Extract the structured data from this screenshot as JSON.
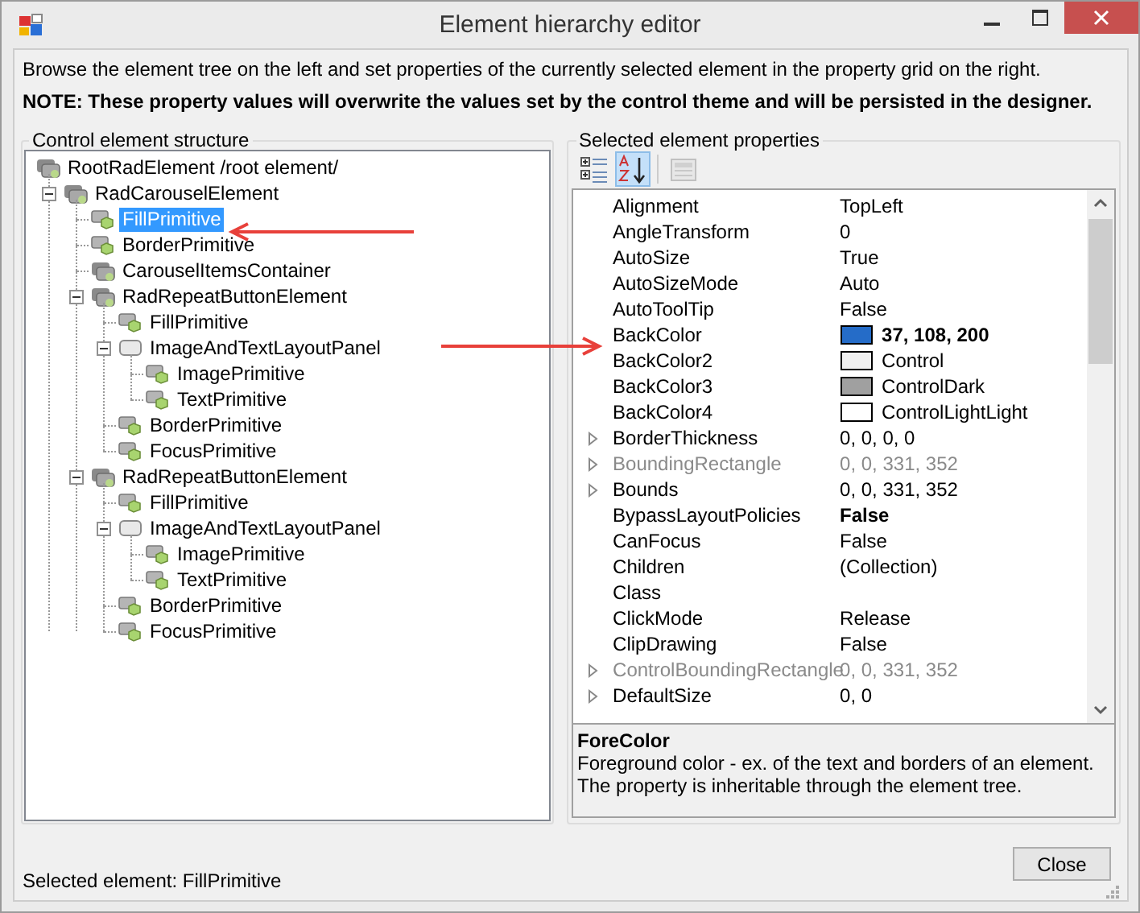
{
  "window": {
    "title": "Element hierarchy editor"
  },
  "intro": "Browse the element tree on the left and set properties of the currently selected element in the property grid on the right.",
  "note": "NOTE: These property values will overwrite the values set by the control theme and will be persisted in the designer.",
  "tree_panel": {
    "title": "Control element structure",
    "nodes": [
      {
        "label": "RootRadElement /root element/",
        "kind": "element",
        "selected": false,
        "expanded": true,
        "children": [
          {
            "label": "RadCarouselElement",
            "kind": "element",
            "selected": false,
            "expanded": true,
            "children": [
              {
                "label": "FillPrimitive",
                "kind": "primitive",
                "selected": true
              },
              {
                "label": "BorderPrimitive",
                "kind": "primitive",
                "selected": false
              },
              {
                "label": "CarouselItemsContainer",
                "kind": "element",
                "selected": false
              },
              {
                "label": "RadRepeatButtonElement",
                "kind": "element",
                "selected": false,
                "expanded": true,
                "children": [
                  {
                    "label": "FillPrimitive",
                    "kind": "primitive",
                    "selected": false
                  },
                  {
                    "label": "ImageAndTextLayoutPanel",
                    "kind": "panel",
                    "selected": false,
                    "expanded": true,
                    "children": [
                      {
                        "label": "ImagePrimitive",
                        "kind": "primitive",
                        "selected": false
                      },
                      {
                        "label": "TextPrimitive",
                        "kind": "primitive",
                        "selected": false
                      }
                    ]
                  },
                  {
                    "label": "BorderPrimitive",
                    "kind": "primitive",
                    "selected": false
                  },
                  {
                    "label": "FocusPrimitive",
                    "kind": "primitive",
                    "selected": false
                  }
                ]
              },
              {
                "label": "RadRepeatButtonElement",
                "kind": "element",
                "selected": false,
                "expanded": true,
                "children": [
                  {
                    "label": "FillPrimitive",
                    "kind": "primitive",
                    "selected": false
                  },
                  {
                    "label": "ImageAndTextLayoutPanel",
                    "kind": "panel",
                    "selected": false,
                    "expanded": true,
                    "children": [
                      {
                        "label": "ImagePrimitive",
                        "kind": "primitive",
                        "selected": false
                      },
                      {
                        "label": "TextPrimitive",
                        "kind": "primitive",
                        "selected": false
                      }
                    ]
                  },
                  {
                    "label": "BorderPrimitive",
                    "kind": "primitive",
                    "selected": false
                  },
                  {
                    "label": "FocusPrimitive",
                    "kind": "primitive",
                    "selected": false
                  }
                ]
              }
            ]
          }
        ]
      }
    ]
  },
  "properties_panel": {
    "title": "Selected element properties",
    "toolbar": [
      {
        "kind": "categorized",
        "selected": false,
        "disabled": false
      },
      {
        "kind": "alphabetical",
        "selected": true,
        "disabled": false
      },
      {
        "kind": "property-pages",
        "selected": false,
        "disabled": true
      }
    ],
    "rows": [
      {
        "name": "Alignment",
        "value": "TopLeft",
        "expandable": false,
        "readonly": false
      },
      {
        "name": "AngleTransform",
        "value": "0",
        "expandable": false,
        "readonly": false
      },
      {
        "name": "AutoSize",
        "value": "True",
        "expandable": false,
        "readonly": false
      },
      {
        "name": "AutoSizeMode",
        "value": "Auto",
        "expandable": false,
        "readonly": false
      },
      {
        "name": "AutoToolTip",
        "value": "False",
        "expandable": false,
        "readonly": false
      },
      {
        "name": "BackColor",
        "value": "37, 108, 200",
        "color": "#256cc8",
        "expandable": false,
        "readonly": false,
        "modified": true
      },
      {
        "name": "BackColor2",
        "value": "Control",
        "color": "#f0f0f0",
        "expandable": false,
        "readonly": false
      },
      {
        "name": "BackColor3",
        "value": "ControlDark",
        "color": "#a0a0a0",
        "expandable": false,
        "readonly": false
      },
      {
        "name": "BackColor4",
        "value": "ControlLightLight",
        "color": "#ffffff",
        "expandable": false,
        "readonly": false
      },
      {
        "name": "BorderThickness",
        "value": "0, 0, 0, 0",
        "expandable": true,
        "readonly": false
      },
      {
        "name": "BoundingRectangle",
        "value": "0, 0, 331, 352",
        "expandable": true,
        "readonly": true
      },
      {
        "name": "Bounds",
        "value": "0, 0, 331, 352",
        "expandable": true,
        "readonly": false
      },
      {
        "name": "BypassLayoutPolicies",
        "value": "False",
        "expandable": false,
        "readonly": false,
        "modified": true
      },
      {
        "name": "CanFocus",
        "value": "False",
        "expandable": false,
        "readonly": false
      },
      {
        "name": "Children",
        "value": "(Collection)",
        "expandable": false,
        "readonly": false
      },
      {
        "name": "Class",
        "expandable": false,
        "readonly": false
      },
      {
        "name": "ClickMode",
        "value": "Release",
        "expandable": false,
        "readonly": false
      },
      {
        "name": "ClipDrawing",
        "value": "False",
        "expandable": false,
        "readonly": false
      },
      {
        "name": "ControlBoundingRectangle",
        "value": "0, 0, 331, 352",
        "expandable": true,
        "readonly": true
      },
      {
        "name": "DefaultSize",
        "value": "0, 0",
        "expandable": true,
        "readonly": false
      }
    ],
    "description": {
      "title": "ForeColor",
      "text": "Foreground color - ex. of the text and borders of an element. The property is inheritable through the element tree."
    }
  },
  "status_bar": "Selected element: FillPrimitive",
  "buttons": [
    {
      "label": "Close"
    }
  ]
}
